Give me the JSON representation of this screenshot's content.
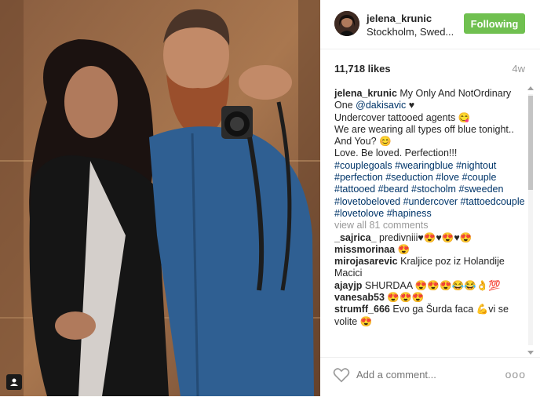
{
  "post": {
    "username": "jelena_krunic",
    "location": "Stockholm, Swed...",
    "follow_label": "Following",
    "likes": "11,718 likes",
    "age": "4w"
  },
  "caption": {
    "username": "jelena_krunic",
    "line1": "My Only And NotOrdinary One",
    "mention": "@dakisavic",
    "line1_end": "♥",
    "line2": "Undercover tattooed agents 😋",
    "line3": "We are wearing all types off blue tonight.. And You? 😊",
    "line4": "Love. Be loved. Perfection!!!",
    "hashtags": "#couplegoals #wearingblue #nightout #perfection #seduction #love #couple #tattooed #beard #stocholm #sweeden #lovetobeloved #undercover #tattoedcouple #lovetolove #hapiness"
  },
  "view_all_comments": "view all 81 comments",
  "comments": [
    {
      "user": "_sajrica_",
      "text": "predivniii♥😍♥😍♥😍"
    },
    {
      "user": "missmorinaa",
      "text": "😍"
    },
    {
      "user": "mirojasarevic",
      "text": "Kraljice poz iz Holandije Macici"
    },
    {
      "user": "ajayjp",
      "text": "SHURDAA 😍😍😍😂😂👌💯"
    },
    {
      "user": "vanesab53",
      "text": "😍😍😍"
    },
    {
      "user": "strumff_666",
      "text": "Evo ga Šurda faca 💪vi se volite 😍"
    }
  ],
  "footer": {
    "comment_placeholder": "Add a comment...",
    "more_label": "ooo"
  },
  "icons": {
    "tag": "person-tag-icon",
    "like": "heart-outline-icon",
    "more": "more-options-icon"
  },
  "colors": {
    "follow_green": "#70c050",
    "hashtag_blue": "#003569",
    "muted_gray": "#999999"
  }
}
